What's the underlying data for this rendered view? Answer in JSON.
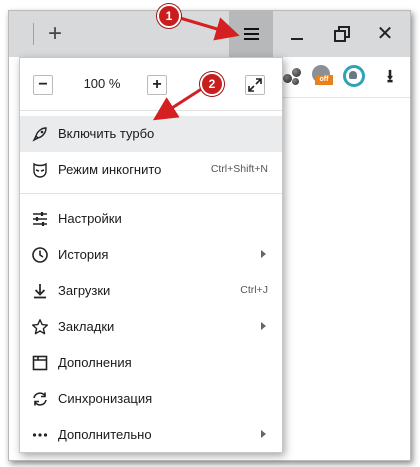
{
  "titlebar": {
    "new_tab_symbol": "+",
    "close_symbol": "✕"
  },
  "toolbar": {
    "icons": [
      "extension-balls-icon",
      "adblock-off-icon",
      "protect-shield-icon",
      "download-icon"
    ],
    "adblock_badge": "off",
    "download_symbol": "⭳"
  },
  "menu": {
    "zoom": {
      "minus": "−",
      "value": "100 %",
      "plus": "+"
    },
    "items": [
      {
        "label": "Включить турбо",
        "icon": "rocket-icon",
        "highlight": true
      },
      {
        "label": "Режим инкогнито",
        "icon": "incognito-mask-icon",
        "shortcut": "Ctrl+Shift+N"
      },
      {
        "label": "Настройки",
        "icon": "settings-sliders-icon"
      },
      {
        "label": "История",
        "icon": "clock-icon",
        "submenu": true
      },
      {
        "label": "Загрузки",
        "icon": "download-arrow-icon",
        "shortcut": "Ctrl+J"
      },
      {
        "label": "Закладки",
        "icon": "star-icon",
        "submenu": true
      },
      {
        "label": "Дополнения",
        "icon": "addons-box-icon"
      },
      {
        "label": "Синхронизация",
        "icon": "sync-icon"
      },
      {
        "label": "Дополнительно",
        "icon": "more-dots-icon",
        "submenu": true
      }
    ]
  },
  "annotations": {
    "badge1": "1",
    "badge2": "2",
    "color": "#d42020"
  }
}
